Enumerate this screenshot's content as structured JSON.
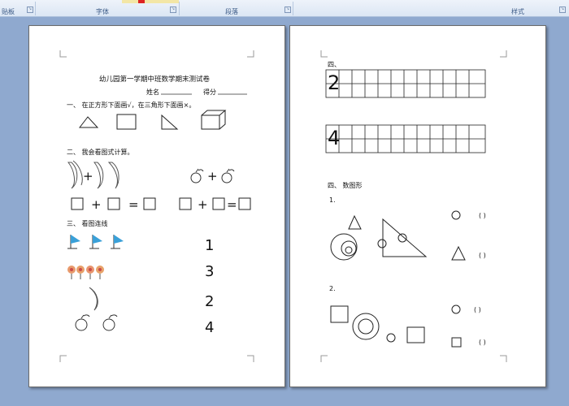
{
  "ribbon": {
    "groups": [
      "贴板",
      "字体",
      "段落",
      "样式"
    ]
  },
  "page1": {
    "title": "幼儿园第一学期中班数学期末测试卷",
    "name_label": "姓名",
    "score_label": "得分",
    "q1": "一、 在正方形下面画√，在三角形下面画×。",
    "q2": "二、 我会看图式计算。",
    "q3": "三、 看图连线",
    "ops": {
      "plus": "+",
      "equals": "="
    },
    "match_numbers": [
      "1",
      "3",
      "2",
      "4"
    ]
  },
  "page2": {
    "q4a": "四、",
    "digits": [
      "2",
      "4"
    ],
    "q4b": "四、 数图形",
    "item1": "1.",
    "item2": "2.",
    "paren": "(   )"
  }
}
